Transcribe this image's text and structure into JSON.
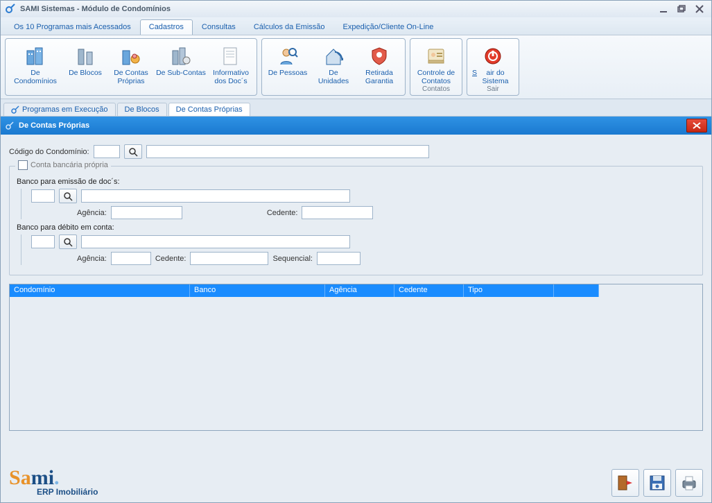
{
  "window": {
    "title": "SAMI Sistemas - Módulo de Condomínios"
  },
  "menu": {
    "items": [
      {
        "label": "Os 10 Programas mais Acessados"
      },
      {
        "label": "Cadastros"
      },
      {
        "label": "Consultas"
      },
      {
        "label": "Cálculos da Emissão"
      },
      {
        "label": "Expedição/Cliente On-Line"
      }
    ],
    "active_index": 1
  },
  "ribbon": {
    "groups": [
      {
        "buttons": [
          {
            "label": "De Condomínios",
            "icon": "buildings"
          },
          {
            "label": "De Blocos",
            "icon": "towers"
          },
          {
            "label": "De Contas Próprias",
            "icon": "accounts"
          },
          {
            "label": "De Sub-Contas",
            "icon": "subaccounts"
          },
          {
            "label": "Informativo dos Doc´s",
            "icon": "docinfo"
          }
        ]
      },
      {
        "buttons": [
          {
            "label": "De Pessoas",
            "icon": "person"
          },
          {
            "label": "De Unidades",
            "icon": "units"
          },
          {
            "label": "Retirada Garantia",
            "icon": "warranty"
          }
        ]
      },
      {
        "buttons": [
          {
            "label": "Controle de Contatos",
            "sub": "Contatos",
            "icon": "contacts"
          }
        ]
      },
      {
        "buttons": [
          {
            "label": "Sair do Sistema",
            "sub": "Sair",
            "icon": "power"
          }
        ]
      }
    ]
  },
  "subtabs": {
    "items": [
      {
        "label": "Programas em Execução",
        "has_icon": true
      },
      {
        "label": "De Blocos"
      },
      {
        "label": "De Contas Próprias"
      }
    ],
    "active_index": 2
  },
  "panel": {
    "title": "De Contas Próprias"
  },
  "form": {
    "codigo_label": "Código do  Condomínio:",
    "checkbox_label": "Conta bancária própria",
    "sec1_label": "Banco para emissão de doc´s:",
    "agencia_label": "Agência:",
    "cedente_label": "Cedente:",
    "sec2_label": "Banco para débito em conta:",
    "sequencial_label": "Sequencial:"
  },
  "grid": {
    "columns": [
      "Condomínio",
      "Banco",
      "Agência",
      "Cedente",
      "Tipo",
      ""
    ]
  },
  "footer": {
    "logo_main": "Sami",
    "logo_sub": "ERP Imobiliário"
  }
}
